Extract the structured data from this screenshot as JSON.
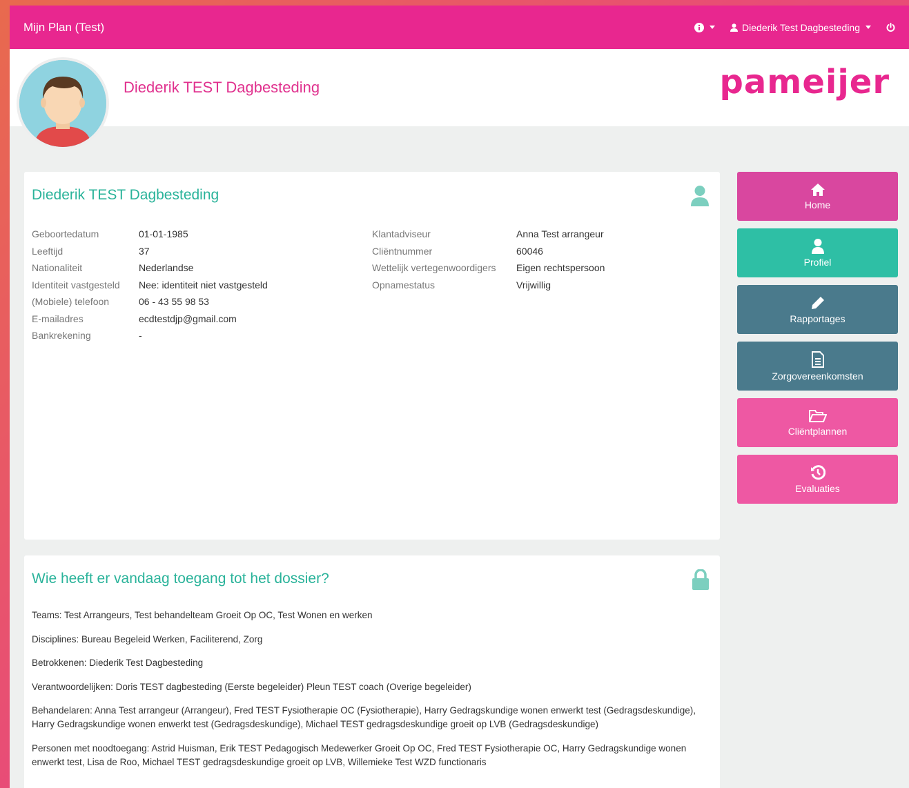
{
  "navbar": {
    "brand": "Mijn Plan (Test)",
    "user_label": "Diederik Test Dagbesteding"
  },
  "header": {
    "name": "Diederik TEST Dagbesteding",
    "logo": "pameijer"
  },
  "profile": {
    "title": "Diederik TEST Dagbesteding",
    "left": [
      {
        "label": "Geboortedatum",
        "value": "01-01-1985"
      },
      {
        "label": "Leeftijd",
        "value": "37"
      },
      {
        "label": "Nationaliteit",
        "value": "Nederlandse"
      },
      {
        "label": "Identiteit vastgesteld",
        "value": "Nee: identiteit niet vastgesteld"
      },
      {
        "label": "(Mobiele) telefoon",
        "value": "06 - 43 55 98 53"
      },
      {
        "label": "E-mailadres",
        "value": "ecdtestdjp@gmail.com"
      },
      {
        "label": "Bankrekening",
        "value": "-"
      }
    ],
    "right": [
      {
        "label": "Klantadviseur",
        "value": "Anna Test arrangeur"
      },
      {
        "label": "Cliëntnummer",
        "value": "60046"
      },
      {
        "label": "Wettelijk vertegenwoordigers",
        "value": "Eigen rechtspersoon"
      },
      {
        "label": "Opnamestatus",
        "value": "Vrijwillig"
      }
    ]
  },
  "access": {
    "title": "Wie heeft er vandaag toegang tot het dossier?",
    "lines": [
      "Teams: Test Arrangeurs, Test behandelteam Groeit Op OC, Test Wonen en werken",
      "Disciplines: Bureau Begeleid Werken, Faciliterend, Zorg",
      "Betrokkenen: Diederik Test Dagbesteding",
      "Verantwoordelijken: Doris TEST dagbesteding (Eerste begeleider) Pleun TEST coach (Overige begeleider)",
      "Behandelaren: Anna Test arrangeur (Arrangeur), Fred TEST Fysiotherapie OC (Fysiotherapie), Harry Gedragskundige wonen enwerkt test (Gedragsdeskundige), Harry Gedragskundige wonen enwerkt test (Gedragsdeskundige), Michael TEST gedragsdeskundige groeit op LVB (Gedragsdeskundige)",
      "Personen met noodtoegang: Astrid Huisman, Erik TEST Pedagogisch Medewerker Groeit Op OC, Fred TEST Fysiotherapie OC, Harry Gedragskundige wonen enwerkt test, Lisa de Roo, Michael TEST gedragsdeskundige groeit op LVB, Willemieke Test WZD functionaris"
    ]
  },
  "sidebar": {
    "tiles": [
      {
        "label": "Home",
        "icon": "home-icon"
      },
      {
        "label": "Profiel",
        "icon": "user-icon"
      },
      {
        "label": "Rapportages",
        "icon": "pencil-icon"
      },
      {
        "label": "Zorgovereenkomsten",
        "icon": "document-icon"
      },
      {
        "label": "Cliëntplannen",
        "icon": "folder-open-icon"
      },
      {
        "label": "Evaluaties",
        "icon": "history-icon"
      }
    ]
  },
  "colors": {
    "navbar": "#e8278f",
    "accent_teal": "#2ab39a",
    "tile_home": "#d9479f",
    "tile_profile": "#2ebfa5",
    "tile_slate": "#4a7a8c",
    "tile_pink": "#ee58a3"
  }
}
